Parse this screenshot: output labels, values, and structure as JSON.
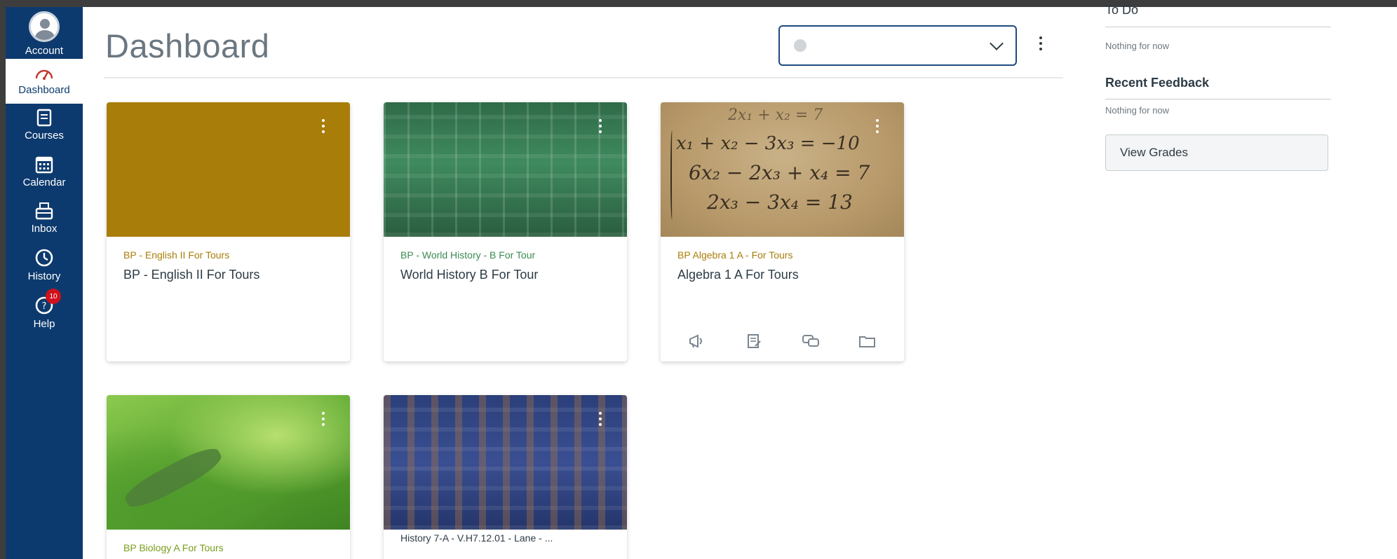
{
  "nav": {
    "account": "Account",
    "dashboard": "Dashboard",
    "courses": "Courses",
    "calendar": "Calendar",
    "inbox": "Inbox",
    "history": "History",
    "help": "Help",
    "help_badge": "10"
  },
  "header": {
    "title": "Dashboard",
    "view_select_value": ""
  },
  "cards": [
    {
      "code": "BP - English II For Tours",
      "title": "BP - English II For Tours",
      "color": "#a97d0a"
    },
    {
      "code": "BP - World History - B For Tour",
      "title": "World History B For Tour",
      "color": "#3b8a53"
    },
    {
      "code": "BP Algebra 1 A - For Tours",
      "title": "Algebra 1 A For Tours",
      "color": "#a97d0a"
    },
    {
      "code": "BP Biology A For Tours",
      "title": "",
      "color": "#7a9d1c"
    },
    {
      "code": "",
      "title": "History 7-A - V.H7.12.01 - Lane - ...",
      "color": "#2b3f7a"
    }
  ],
  "math": {
    "line1": "2x₁ + x₂ = 7",
    "line2": "x₁ + x₂ − 3x₃ = −10",
    "line3": "6x₂ − 2x₃ + x₄ = 7",
    "line4": "2x₃ − 3x₄ = 13"
  },
  "card_action_icons": [
    "announcements-icon",
    "assignments-icon",
    "discussions-icon",
    "files-icon"
  ],
  "sidebar": {
    "todo_heading": "To Do",
    "todo_empty": "Nothing for now",
    "feedback_heading": "Recent Feedback",
    "feedback_empty": "Nothing for now",
    "view_grades": "View Grades"
  },
  "colors": {
    "nav_bg": "#0d3a6e",
    "accent_border": "#1f4b7d",
    "badge": "#d0111c"
  }
}
